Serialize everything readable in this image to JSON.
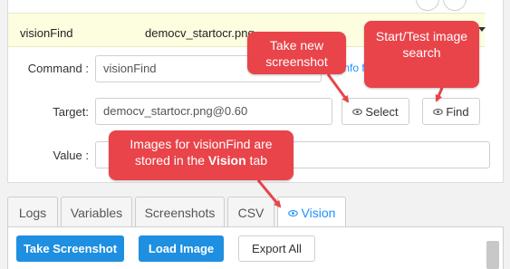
{
  "table_row": {
    "command": "visionFind",
    "target": "democv_startocr.png"
  },
  "form": {
    "command_label": "Command :",
    "command_value": "visionFind",
    "info_link": "Info for this command",
    "target_label": "Target:",
    "target_value": "democv_startocr.png@0.60",
    "select_label": "Select",
    "find_label": "Find",
    "value_label": "Value :",
    "value_value": ""
  },
  "tabs": [
    {
      "label": "Logs"
    },
    {
      "label": "Variables"
    },
    {
      "label": "Screenshots"
    },
    {
      "label": "CSV"
    },
    {
      "label": "Vision",
      "active": true
    }
  ],
  "vision_panel": {
    "take_screenshot": "Take Screenshot",
    "load_image": "Load Image",
    "export_all": "Export All"
  },
  "callouts": {
    "take_new_screenshot": "Take new screenshot",
    "start_test": "Start/Test image search",
    "images_stored_pre": "Images for visionFind are stored in the ",
    "images_stored_bold": "Vision",
    "images_stored_post": " tab"
  },
  "colors": {
    "accent": "#1e8fe1",
    "callout": "#e8444a",
    "highlight_row": "#fdfde0"
  }
}
